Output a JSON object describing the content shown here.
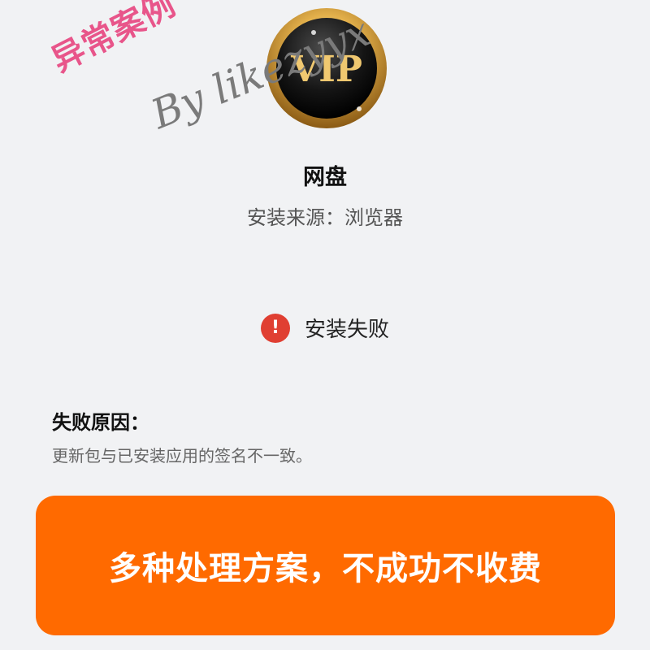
{
  "badge": {
    "text": "VIP"
  },
  "stamp": {
    "text": "异常案例"
  },
  "watermark": {
    "text": "By likezyyx"
  },
  "app": {
    "name": "网盘",
    "install_source": "安装来源：浏览器"
  },
  "status": {
    "text": "安装失败",
    "icon": "exclamation-icon",
    "icon_glyph": "!",
    "color": "#e03f32"
  },
  "failure": {
    "title": "失败原因：",
    "reason": "更新包与已安装应用的签名不一致。"
  },
  "promo": {
    "text": "多种处理方案，不成功不收费",
    "color": "#ff6a00"
  }
}
